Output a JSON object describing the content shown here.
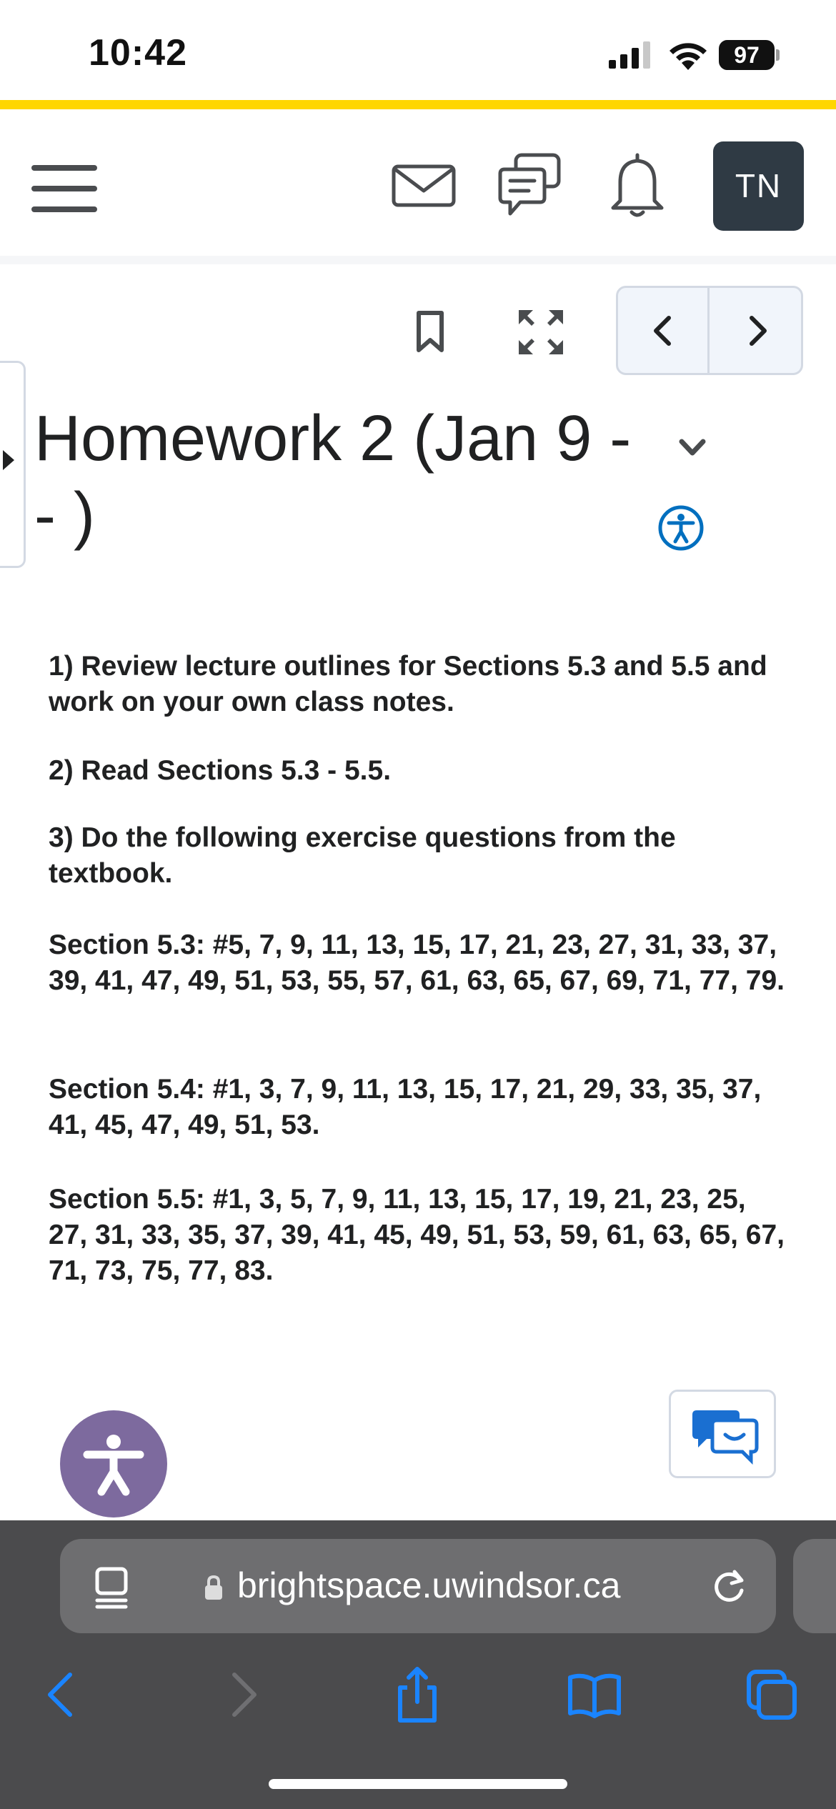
{
  "status_bar": {
    "time": "10:42",
    "battery": "97",
    "icons": [
      "signal-icon",
      "wifi-icon",
      "battery-icon"
    ]
  },
  "top_nav": {
    "avatar_initials": "TN",
    "icons": [
      "menu-icon",
      "mail-icon",
      "chat-icon",
      "bell-icon"
    ]
  },
  "toolbar": {
    "icons": [
      "bookmark-icon",
      "fullscreen-icon",
      "chevron-left-icon",
      "chevron-right-icon"
    ]
  },
  "page": {
    "title_line1": "Homework 2 (Jan 9 -",
    "title_line2": "- )"
  },
  "content": {
    "item1": "1) Review lecture outlines for Sections 5.3 and 5.5 and work on your own class notes.",
    "item2": "2) Read Sections 5.3 - 5.5.",
    "item3": "3) Do the following exercise questions from the textbook.",
    "section53": "Section 5.3: #5, 7, 9, 11, 13, 15, 17, 21, 23, 27, 31, 33, 37, 39, 41, 47, 49, 51, 53, 55, 57, 61, 63, 65, 67, 69, 71, 77, 79.",
    "section54": "Section 5.4: #1, 3, 7, 9, 11, 13, 15, 17, 21, 29, 33, 35, 37, 41, 45, 47, 49, 51, 53.",
    "section55": "Section 5.5: #1, 3, 5, 7, 9, 11, 13, 15, 17, 19, 21, 23, 25, 27, 31, 33, 35, 37, 39, 41, 45, 49, 51, 53, 59, 61, 63, 65, 67, 71, 73, 75, 77, 83."
  },
  "browser": {
    "url": "brightspace.uwindsor.ca"
  },
  "colors": {
    "accent": "#ffd600",
    "avatar_bg": "#2f3a44",
    "accessibility_button": "#7d6a9e",
    "link_blue": "#006fbf",
    "browser_bg": "#4b4b4d",
    "browser_icon": "#1a84ff"
  }
}
